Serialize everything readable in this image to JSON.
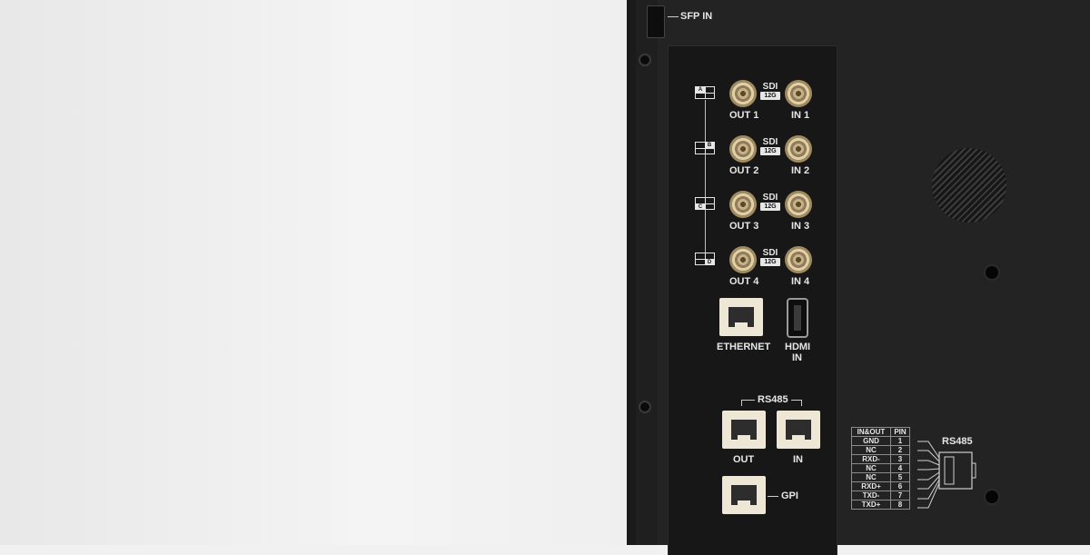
{
  "sfp": {
    "label": "SFP IN"
  },
  "sdi_ports": [
    {
      "quad": "A",
      "format": "SDI",
      "badge": "12G",
      "out_label": "OUT 1",
      "in_label": "IN 1"
    },
    {
      "quad": "B",
      "format": "SDI",
      "badge": "12G",
      "out_label": "OUT 2",
      "in_label": "IN 2"
    },
    {
      "quad": "C",
      "format": "SDI",
      "badge": "12G",
      "out_label": "OUT 3",
      "in_label": "IN 3"
    },
    {
      "quad": "D",
      "format": "SDI",
      "badge": "12G",
      "out_label": "OUT 4",
      "in_label": "IN 4"
    }
  ],
  "ethernet": {
    "label": "ETHERNET"
  },
  "hdmi": {
    "label_line1": "HDMI",
    "label_line2": "IN"
  },
  "rs485": {
    "title": "RS485",
    "out_label": "OUT",
    "in_label": "IN"
  },
  "gpi": {
    "label": "GPI"
  },
  "pin_table": {
    "title": "RS485",
    "header": [
      "IN&OUT",
      "PIN"
    ],
    "rows": [
      [
        "GND",
        "1"
      ],
      [
        "NC",
        "2"
      ],
      [
        "RXD-",
        "3"
      ],
      [
        "NC",
        "4"
      ],
      [
        "NC",
        "5"
      ],
      [
        "RXD+",
        "6"
      ],
      [
        "TXD-",
        "7"
      ],
      [
        "TXD+",
        "8"
      ]
    ]
  },
  "colors": {
    "panel": "#171717",
    "device": "#232323",
    "connector_gold": "#c7b188",
    "rj45_body": "#efe7d6"
  }
}
